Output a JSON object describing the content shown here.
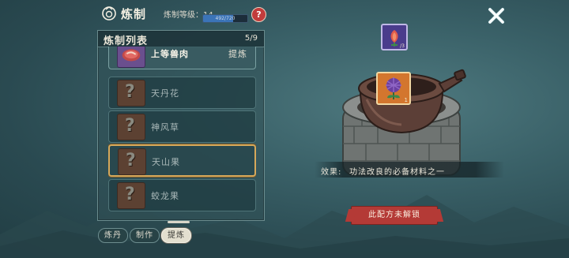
{
  "header": {
    "title": "炼制",
    "level_label": "炼制等级：14",
    "exp_text": "492/720",
    "exp_fraction": 0.683,
    "help_glyph": "?"
  },
  "list": {
    "title": "炼制列表",
    "count": "5/9",
    "items": [
      {
        "name": "上等兽肉",
        "action": "提炼",
        "icon": "meat-icon",
        "unlocked": true
      },
      {
        "name": "天丹花",
        "icon": "unknown-icon",
        "unlocked": false
      },
      {
        "name": "神风草",
        "icon": "unknown-icon",
        "unlocked": false
      },
      {
        "name": "天山果",
        "icon": "unknown-icon",
        "unlocked": false,
        "selected": true
      },
      {
        "name": "蛟龙果",
        "icon": "unknown-icon",
        "unlocked": false
      }
    ],
    "unknown_glyph": "?"
  },
  "tabs": [
    {
      "label": "炼丹",
      "active": false
    },
    {
      "label": "制作",
      "active": false
    },
    {
      "label": "提炼",
      "active": true
    }
  ],
  "craft": {
    "result_count": "/3",
    "material_count": "1",
    "effect_label": "效果:",
    "effect_text": "功法改良的必备材料之一",
    "locked_button": "此配方未解锁"
  },
  "colors": {
    "accent_red": "#b43a36",
    "selected_border": "#d6a85a",
    "exp_bar": "#3b74b8"
  }
}
